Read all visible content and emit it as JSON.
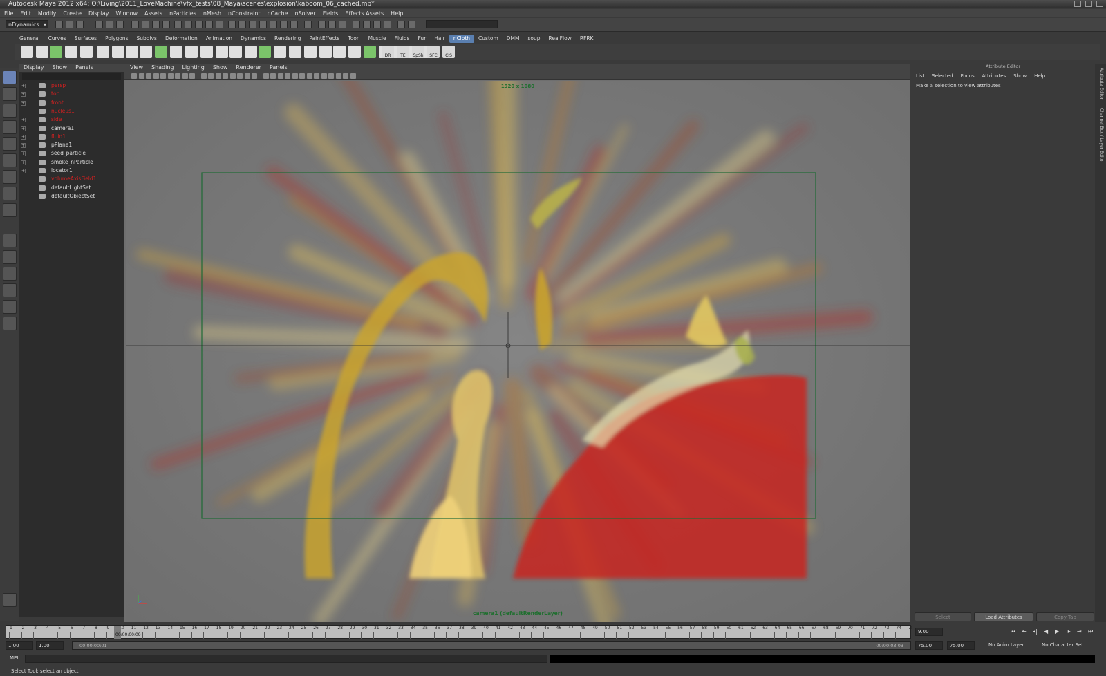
{
  "window": {
    "title": "Autodesk Maya 2012 x64: O:\\Living\\2011_LoveMachine\\vfx_tests\\08_Maya\\scenes\\explosion\\kaboom_06_cached.mb*"
  },
  "menubar": [
    "File",
    "Edit",
    "Modify",
    "Create",
    "Display",
    "Window",
    "Assets",
    "nParticles",
    "nMesh",
    "nConstraint",
    "nCache",
    "nSolver",
    "Fields",
    "Effects Assets",
    "Help"
  ],
  "statusline": {
    "menu_set": "nDynamics"
  },
  "shelf": {
    "tabs": [
      "General",
      "Curves",
      "Surfaces",
      "Polygons",
      "Subdivs",
      "Deformation",
      "Animation",
      "Dynamics",
      "Rendering",
      "PaintEffects",
      "Toon",
      "Muscle",
      "Fluids",
      "Fur",
      "Hair",
      "nCloth",
      "Custom",
      "DMM",
      "soup",
      "RealFlow",
      "RFRK"
    ],
    "active_tab": "nCloth",
    "labeled_icons": [
      "DR",
      "TE",
      "SpSh",
      "SFC",
      "CIS"
    ]
  },
  "outliner": {
    "menu": [
      "Display",
      "Show",
      "Panels"
    ],
    "items": [
      {
        "name": "persp",
        "color": "#d32020",
        "expand": true
      },
      {
        "name": "top",
        "color": "#d32020",
        "expand": true
      },
      {
        "name": "front",
        "color": "#d32020",
        "expand": true
      },
      {
        "name": "nucleus1",
        "color": "#d32020",
        "expand": false
      },
      {
        "name": "side",
        "color": "#d32020",
        "expand": true
      },
      {
        "name": "camera1",
        "color": "#dcdcdc",
        "expand": true
      },
      {
        "name": "fluid1",
        "color": "#d32020",
        "expand": true
      },
      {
        "name": "pPlane1",
        "color": "#dcdcdc",
        "expand": true
      },
      {
        "name": "seed_particle",
        "color": "#dcdcdc",
        "expand": true
      },
      {
        "name": "smoke_nParticle",
        "color": "#dcdcdc",
        "expand": true
      },
      {
        "name": "locator1",
        "color": "#dcdcdc",
        "expand": true
      },
      {
        "name": "volumeAxisField1",
        "color": "#d32020",
        "expand": false
      },
      {
        "name": "defaultLightSet",
        "color": "#dcdcdc",
        "expand": false
      },
      {
        "name": "defaultObjectSet",
        "color": "#dcdcdc",
        "expand": false
      }
    ]
  },
  "viewport": {
    "menu": [
      "View",
      "Shading",
      "Lighting",
      "Show",
      "Renderer",
      "Panels"
    ],
    "resolution_label": "1920 x 1080",
    "camera_label": "camera1 (defaultRenderLayer)"
  },
  "attribute_editor": {
    "title": "Attribute Editor",
    "menu": [
      "List",
      "Selected",
      "Focus",
      "Attributes",
      "Show",
      "Help"
    ],
    "message": "Make a selection to view attributes",
    "buttons": {
      "select": "Select",
      "load": "Load Attributes",
      "copy": "Copy Tab"
    }
  },
  "side_tabs": [
    "Attribute Editor",
    "Channel Box / Layer Editor"
  ],
  "timeline": {
    "start": 1,
    "end": 75,
    "current_time_label": "00:00:00:09",
    "current_frame_field": "9.00"
  },
  "range": {
    "start_field": "1.00",
    "anim_start_field": "1.00",
    "range_start_label": "00:00:00:01",
    "range_end_label": "00:00:03:03",
    "end_field": "75.00",
    "anim_end_field": "75.00",
    "anim_layer": "No Anim Layer",
    "character_set": "No Character Set"
  },
  "command_line": {
    "language": "MEL"
  },
  "help_line": {
    "text": "Select Tool: select an object"
  }
}
